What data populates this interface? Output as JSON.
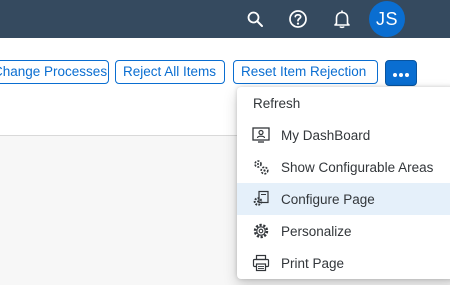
{
  "shell": {
    "user_initials": "JS",
    "colors": {
      "shell_bg": "#354a5f",
      "avatar_bg": "#0a6ed1"
    },
    "icons": [
      "search-icon",
      "help-icon",
      "notification-bell-icon"
    ]
  },
  "toolbar": {
    "buttons": [
      {
        "label": "Change Processes"
      },
      {
        "label": "Reject All Items"
      },
      {
        "label": "Reset Item Rejection"
      }
    ],
    "more_icon": "overflow-more-icon",
    "accent": "#0a6ed1"
  },
  "menu": {
    "items": [
      {
        "label": "Refresh",
        "icon": ""
      },
      {
        "label": "My DashBoard",
        "icon": "dashboard-icon"
      },
      {
        "label": "Show Configurable Areas",
        "icon": "configurable-areas-icon"
      },
      {
        "label": "Configure Page",
        "icon": "configure-page-icon",
        "selected": true
      },
      {
        "label": "Personalize",
        "icon": "personalize-gear-icon"
      },
      {
        "label": "Print Page",
        "icon": "print-icon"
      }
    ]
  }
}
